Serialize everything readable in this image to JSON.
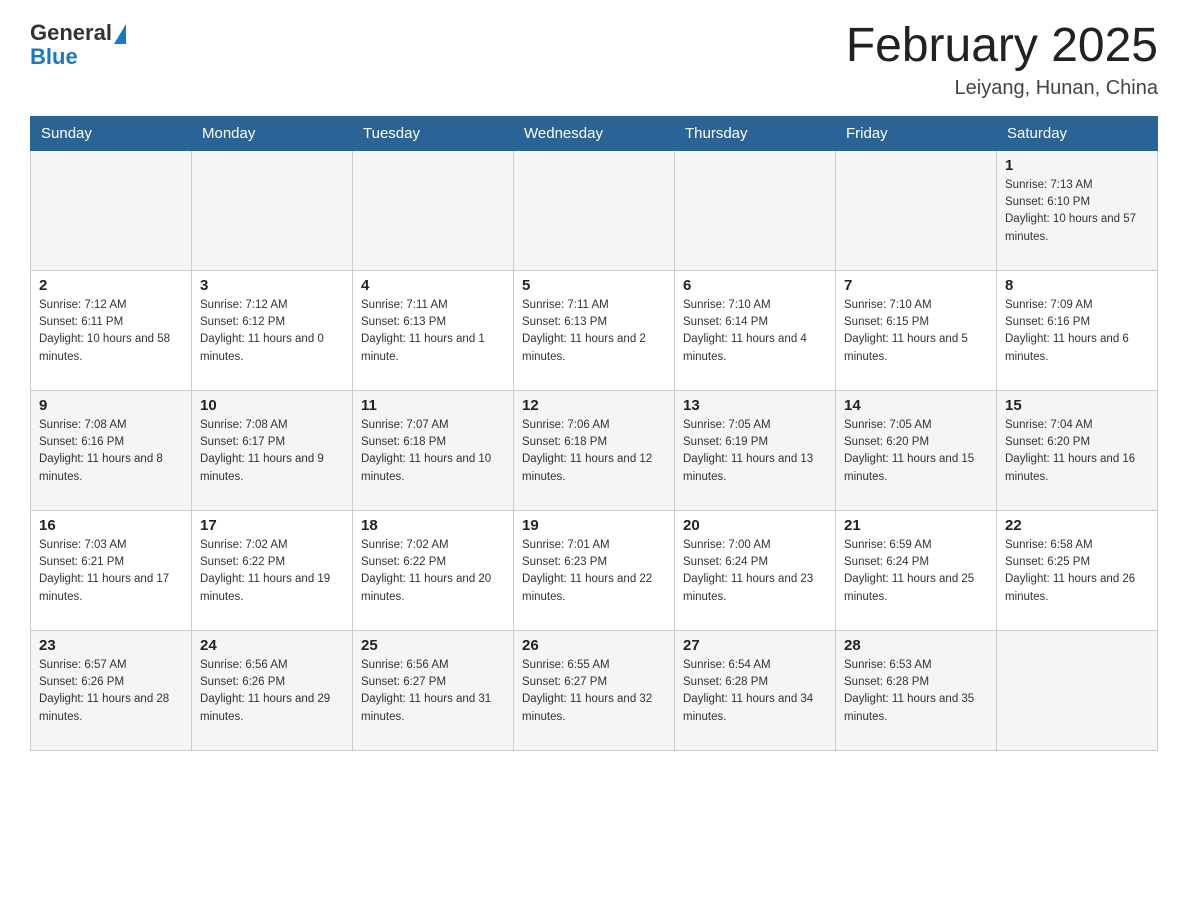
{
  "header": {
    "logo": {
      "general": "General",
      "blue": "Blue"
    },
    "title": "February 2025",
    "location": "Leiyang, Hunan, China"
  },
  "days_of_week": [
    "Sunday",
    "Monday",
    "Tuesday",
    "Wednesday",
    "Thursday",
    "Friday",
    "Saturday"
  ],
  "weeks": [
    {
      "days": [
        {
          "date": "",
          "info": ""
        },
        {
          "date": "",
          "info": ""
        },
        {
          "date": "",
          "info": ""
        },
        {
          "date": "",
          "info": ""
        },
        {
          "date": "",
          "info": ""
        },
        {
          "date": "",
          "info": ""
        },
        {
          "date": "1",
          "sunrise": "Sunrise: 7:13 AM",
          "sunset": "Sunset: 6:10 PM",
          "daylight": "Daylight: 10 hours and 57 minutes."
        }
      ]
    },
    {
      "days": [
        {
          "date": "2",
          "sunrise": "Sunrise: 7:12 AM",
          "sunset": "Sunset: 6:11 PM",
          "daylight": "Daylight: 10 hours and 58 minutes."
        },
        {
          "date": "3",
          "sunrise": "Sunrise: 7:12 AM",
          "sunset": "Sunset: 6:12 PM",
          "daylight": "Daylight: 11 hours and 0 minutes."
        },
        {
          "date": "4",
          "sunrise": "Sunrise: 7:11 AM",
          "sunset": "Sunset: 6:13 PM",
          "daylight": "Daylight: 11 hours and 1 minute."
        },
        {
          "date": "5",
          "sunrise": "Sunrise: 7:11 AM",
          "sunset": "Sunset: 6:13 PM",
          "daylight": "Daylight: 11 hours and 2 minutes."
        },
        {
          "date": "6",
          "sunrise": "Sunrise: 7:10 AM",
          "sunset": "Sunset: 6:14 PM",
          "daylight": "Daylight: 11 hours and 4 minutes."
        },
        {
          "date": "7",
          "sunrise": "Sunrise: 7:10 AM",
          "sunset": "Sunset: 6:15 PM",
          "daylight": "Daylight: 11 hours and 5 minutes."
        },
        {
          "date": "8",
          "sunrise": "Sunrise: 7:09 AM",
          "sunset": "Sunset: 6:16 PM",
          "daylight": "Daylight: 11 hours and 6 minutes."
        }
      ]
    },
    {
      "days": [
        {
          "date": "9",
          "sunrise": "Sunrise: 7:08 AM",
          "sunset": "Sunset: 6:16 PM",
          "daylight": "Daylight: 11 hours and 8 minutes."
        },
        {
          "date": "10",
          "sunrise": "Sunrise: 7:08 AM",
          "sunset": "Sunset: 6:17 PM",
          "daylight": "Daylight: 11 hours and 9 minutes."
        },
        {
          "date": "11",
          "sunrise": "Sunrise: 7:07 AM",
          "sunset": "Sunset: 6:18 PM",
          "daylight": "Daylight: 11 hours and 10 minutes."
        },
        {
          "date": "12",
          "sunrise": "Sunrise: 7:06 AM",
          "sunset": "Sunset: 6:18 PM",
          "daylight": "Daylight: 11 hours and 12 minutes."
        },
        {
          "date": "13",
          "sunrise": "Sunrise: 7:05 AM",
          "sunset": "Sunset: 6:19 PM",
          "daylight": "Daylight: 11 hours and 13 minutes."
        },
        {
          "date": "14",
          "sunrise": "Sunrise: 7:05 AM",
          "sunset": "Sunset: 6:20 PM",
          "daylight": "Daylight: 11 hours and 15 minutes."
        },
        {
          "date": "15",
          "sunrise": "Sunrise: 7:04 AM",
          "sunset": "Sunset: 6:20 PM",
          "daylight": "Daylight: 11 hours and 16 minutes."
        }
      ]
    },
    {
      "days": [
        {
          "date": "16",
          "sunrise": "Sunrise: 7:03 AM",
          "sunset": "Sunset: 6:21 PM",
          "daylight": "Daylight: 11 hours and 17 minutes."
        },
        {
          "date": "17",
          "sunrise": "Sunrise: 7:02 AM",
          "sunset": "Sunset: 6:22 PM",
          "daylight": "Daylight: 11 hours and 19 minutes."
        },
        {
          "date": "18",
          "sunrise": "Sunrise: 7:02 AM",
          "sunset": "Sunset: 6:22 PM",
          "daylight": "Daylight: 11 hours and 20 minutes."
        },
        {
          "date": "19",
          "sunrise": "Sunrise: 7:01 AM",
          "sunset": "Sunset: 6:23 PM",
          "daylight": "Daylight: 11 hours and 22 minutes."
        },
        {
          "date": "20",
          "sunrise": "Sunrise: 7:00 AM",
          "sunset": "Sunset: 6:24 PM",
          "daylight": "Daylight: 11 hours and 23 minutes."
        },
        {
          "date": "21",
          "sunrise": "Sunrise: 6:59 AM",
          "sunset": "Sunset: 6:24 PM",
          "daylight": "Daylight: 11 hours and 25 minutes."
        },
        {
          "date": "22",
          "sunrise": "Sunrise: 6:58 AM",
          "sunset": "Sunset: 6:25 PM",
          "daylight": "Daylight: 11 hours and 26 minutes."
        }
      ]
    },
    {
      "days": [
        {
          "date": "23",
          "sunrise": "Sunrise: 6:57 AM",
          "sunset": "Sunset: 6:26 PM",
          "daylight": "Daylight: 11 hours and 28 minutes."
        },
        {
          "date": "24",
          "sunrise": "Sunrise: 6:56 AM",
          "sunset": "Sunset: 6:26 PM",
          "daylight": "Daylight: 11 hours and 29 minutes."
        },
        {
          "date": "25",
          "sunrise": "Sunrise: 6:56 AM",
          "sunset": "Sunset: 6:27 PM",
          "daylight": "Daylight: 11 hours and 31 minutes."
        },
        {
          "date": "26",
          "sunrise": "Sunrise: 6:55 AM",
          "sunset": "Sunset: 6:27 PM",
          "daylight": "Daylight: 11 hours and 32 minutes."
        },
        {
          "date": "27",
          "sunrise": "Sunrise: 6:54 AM",
          "sunset": "Sunset: 6:28 PM",
          "daylight": "Daylight: 11 hours and 34 minutes."
        },
        {
          "date": "28",
          "sunrise": "Sunrise: 6:53 AM",
          "sunset": "Sunset: 6:28 PM",
          "daylight": "Daylight: 11 hours and 35 minutes."
        },
        {
          "date": "",
          "info": ""
        }
      ]
    }
  ]
}
